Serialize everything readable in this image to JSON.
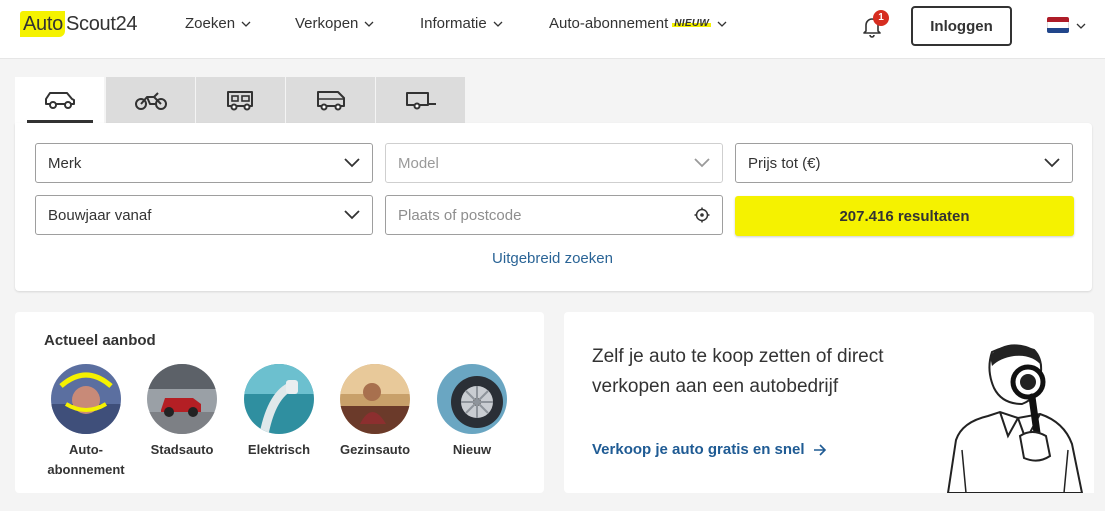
{
  "header": {
    "logo_part1": "Auto",
    "logo_part2": "Scout24",
    "nav": [
      {
        "label": "Zoeken"
      },
      {
        "label": "Verkopen"
      },
      {
        "label": "Informatie"
      },
      {
        "label": "Auto-abonnement",
        "badge": "NIEUW"
      }
    ],
    "notification_count": "1",
    "login_label": "Inloggen",
    "language_flag_colors": [
      "#ae1c28",
      "#ffffff",
      "#21468b"
    ]
  },
  "vehicle_tabs": [
    {
      "icon": "car-icon",
      "active": true
    },
    {
      "icon": "motorbike-icon",
      "active": false
    },
    {
      "icon": "camper-icon",
      "active": false
    },
    {
      "icon": "van-icon",
      "active": false
    },
    {
      "icon": "trailer-icon",
      "active": false
    }
  ],
  "search": {
    "make_label": "Merk",
    "model_label": "Model",
    "price_label": "Prijs tot (€)",
    "year_label": "Bouwjaar vanaf",
    "location_placeholder": "Plaats of postcode",
    "results_button": "207.416 resultaten",
    "advanced_link": "Uitgebreid zoeken"
  },
  "offers": {
    "title": "Actueel aanbod",
    "categories": [
      {
        "label_line1": "Auto-",
        "label_line2": "abonnement"
      },
      {
        "label_line1": "Stadsauto"
      },
      {
        "label_line1": "Elektrisch"
      },
      {
        "label_line1": "Gezinsauto"
      },
      {
        "label_line1": "Nieuw"
      }
    ]
  },
  "sell": {
    "heading": "Zelf je auto te koop zetten of direct verkopen aan een autobedrijf",
    "link": "Verkoop je auto gratis en snel"
  },
  "colors": {
    "brand_yellow": "#f5f200",
    "link_blue": "#1f5b94",
    "badge_red": "#d62d20"
  }
}
